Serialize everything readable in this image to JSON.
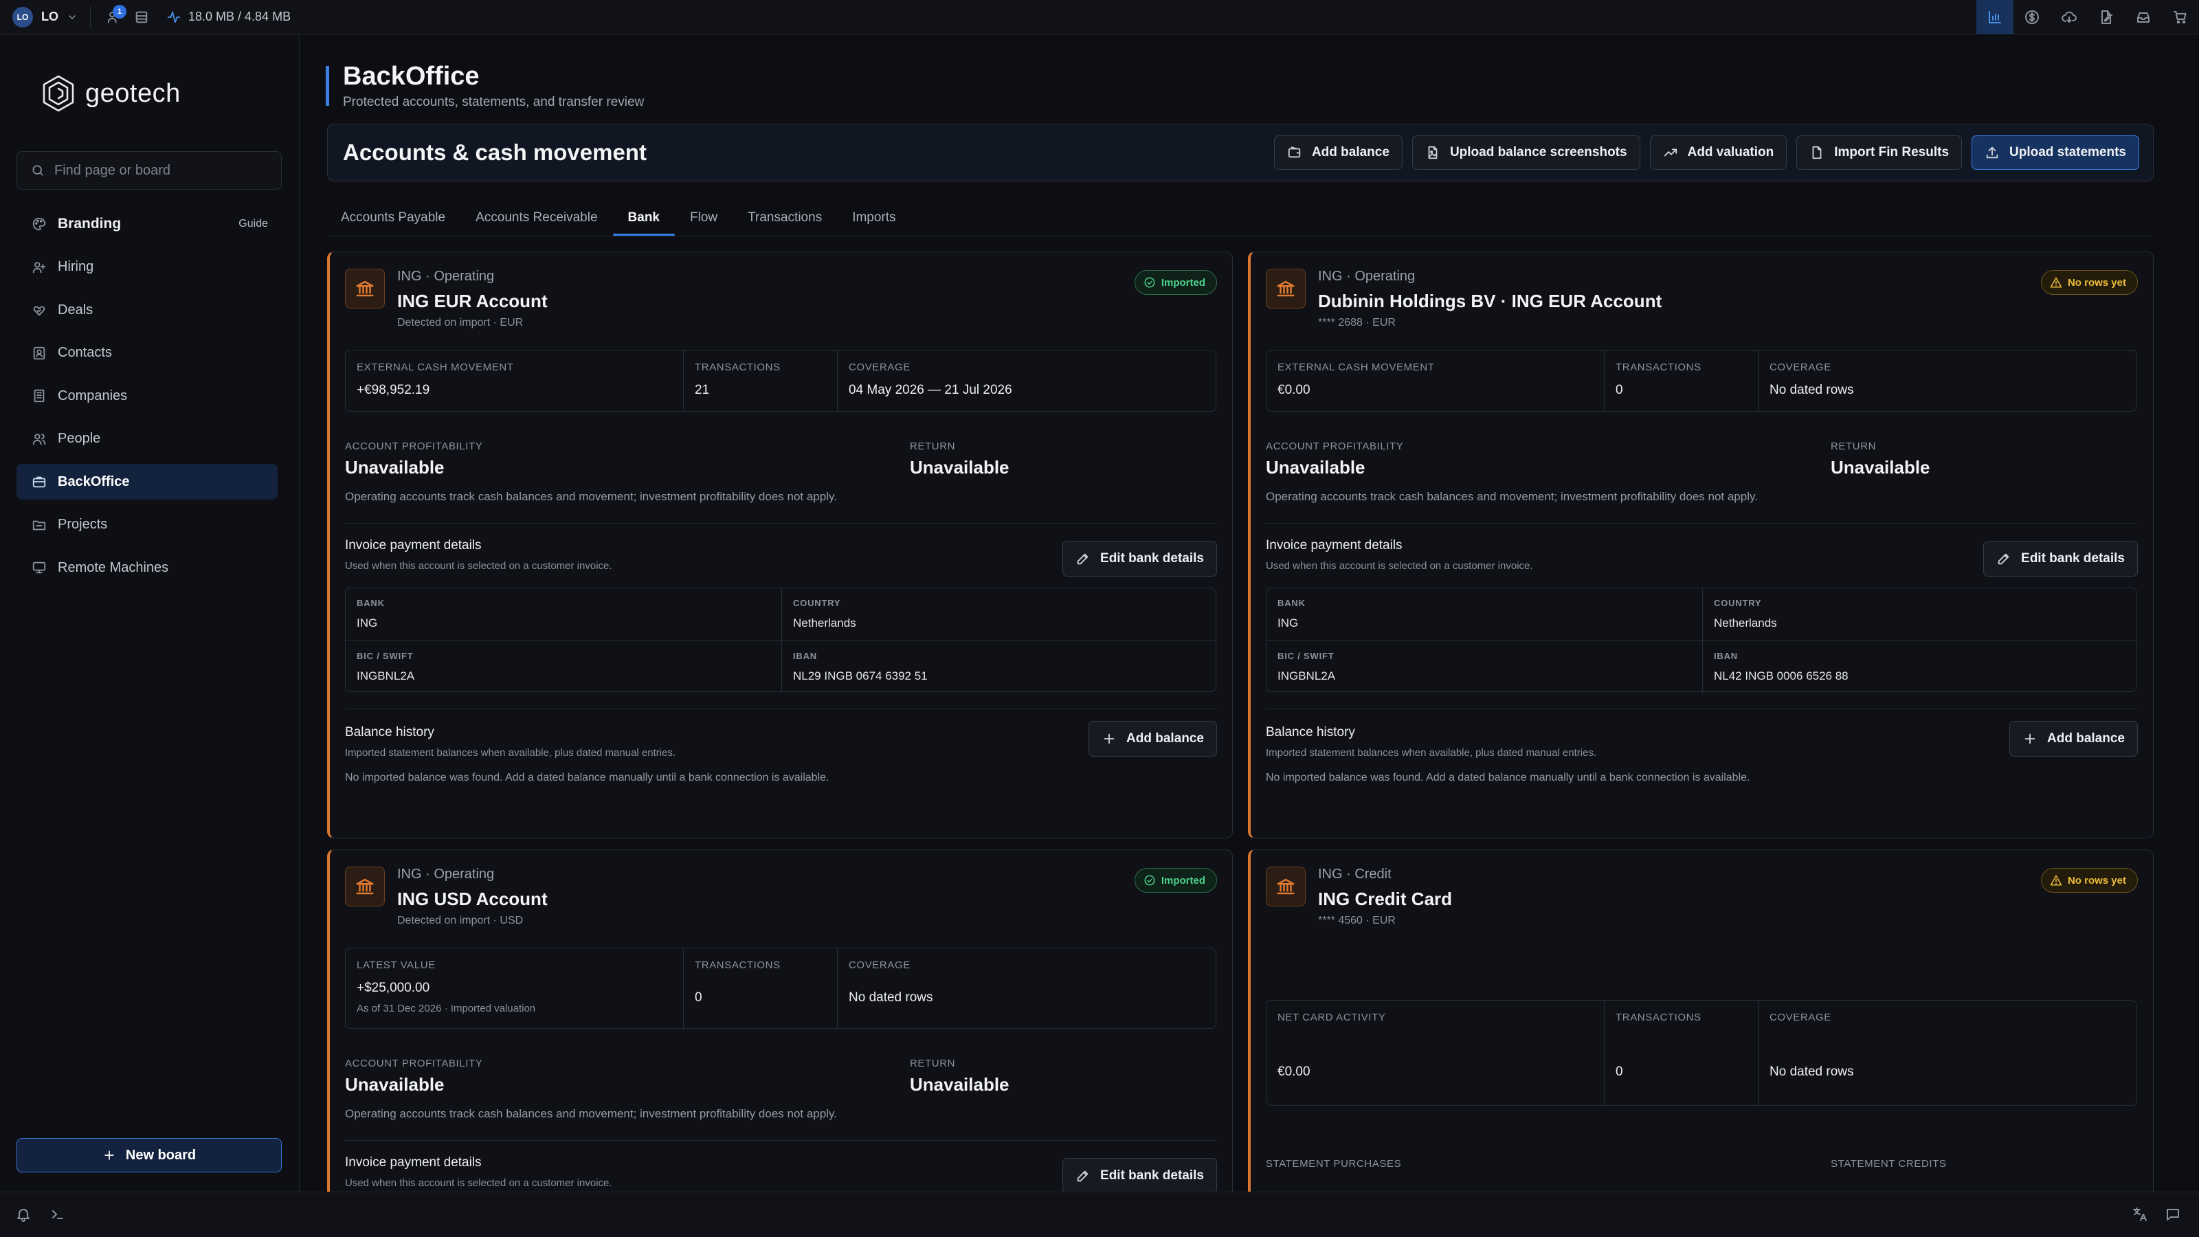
{
  "topbar": {
    "avatar_initials": "LO",
    "user_label": "LO",
    "notification_count": "1",
    "memory": "18.0 MB / 4.84 MB",
    "accent": "#3b7ee6"
  },
  "sidebar": {
    "logo_text": "geotech",
    "search_placeholder": "Find page or board",
    "items": [
      {
        "label": "Branding",
        "extra": "Guide",
        "icon": "palette-icon"
      },
      {
        "label": "Hiring",
        "icon": "user-plus-icon"
      },
      {
        "label": "Deals",
        "icon": "handshake-icon"
      },
      {
        "label": "Contacts",
        "icon": "contact-card-icon"
      },
      {
        "label": "Companies",
        "icon": "building-icon"
      },
      {
        "label": "People",
        "icon": "people-icon"
      },
      {
        "label": "BackOffice",
        "icon": "briefcase-icon"
      },
      {
        "label": "Projects",
        "icon": "folder-icon"
      },
      {
        "label": "Remote Machines",
        "icon": "monitor-icon"
      }
    ],
    "new_board_label": "New board"
  },
  "page": {
    "title": "BackOffice",
    "subtitle": "Protected accounts, statements, and transfer review",
    "section_title": "Accounts & cash movement",
    "actions": [
      "Add balance",
      "Upload balance screenshots",
      "Add valuation",
      "Import Fin Results",
      "Upload statements"
    ],
    "tabs": [
      "Accounts Payable",
      "Accounts Receivable",
      "Bank",
      "Flow",
      "Transactions",
      "Imports"
    ],
    "active_tab": "Bank"
  },
  "labels": {
    "account_profitability": "ACCOUNT PROFITABILITY",
    "return": "RETURN",
    "invoice_payment_details": "Invoice payment details",
    "invoice_payment_sub": "Used when this account is selected on a customer invoice.",
    "edit_bank_details": "Edit bank details",
    "bank": "BANK",
    "country": "COUNTRY",
    "bic_swift": "BIC / SWIFT",
    "iban": "IBAN",
    "balance_history": "Balance history",
    "balance_history_sub": "Imported statement balances when available, plus dated manual entries.",
    "add_balance": "Add balance",
    "operating_note": "Operating accounts track cash balances and movement; investment profitability does not apply.",
    "no_balance_note": "No imported balance was found. Add a dated balance manually until a bank connection is available.",
    "statement_purchases": "STATEMENT PURCHASES",
    "statement_credits": "STATEMENT CREDITS"
  },
  "accounts": [
    {
      "kicker": "ING · Operating",
      "title": "ING EUR Account",
      "sub": "Detected on import · EUR",
      "badge": "Imported",
      "metrics": [
        {
          "label": "EXTERNAL CASH MOVEMENT",
          "value": "+€98,952.19"
        },
        {
          "label": "TRANSACTIONS",
          "value": "21"
        },
        {
          "label": "COVERAGE",
          "value": "04 May 2026 — 21 Jul 2026"
        }
      ],
      "profitability": "Unavailable",
      "return": "Unavailable",
      "bank": "ING",
      "country": "Netherlands",
      "bic": "INGBNL2A",
      "iban": "NL29 INGB 0674 6392 51"
    },
    {
      "kicker": "ING · Operating",
      "title": "Dubinin Holdings BV · ING EUR Account",
      "sub": "**** 2688 · EUR",
      "badge": "No rows yet",
      "metrics": [
        {
          "label": "EXTERNAL CASH MOVEMENT",
          "value": "€0.00"
        },
        {
          "label": "TRANSACTIONS",
          "value": "0"
        },
        {
          "label": "COVERAGE",
          "value": "No dated rows"
        }
      ],
      "profitability": "Unavailable",
      "return": "Unavailable",
      "bank": "ING",
      "country": "Netherlands",
      "bic": "INGBNL2A",
      "iban": "NL42 INGB 0006 6526 88"
    },
    {
      "kicker": "ING · Operating",
      "title": "ING USD Account",
      "sub": "Detected on import · USD",
      "badge": "Imported",
      "metrics": [
        {
          "label": "LATEST VALUE",
          "value": "+$25,000.00",
          "note": "As of 31 Dec 2026 · Imported valuation"
        },
        {
          "label": "TRANSACTIONS",
          "value": "0"
        },
        {
          "label": "COVERAGE",
          "value": "No dated rows"
        }
      ],
      "profitability": "Unavailable",
      "return": "Unavailable"
    },
    {
      "kicker": "ING · Credit",
      "title": "ING Credit Card",
      "sub": "**** 4560 · EUR",
      "badge": "No rows yet",
      "metrics": [
        {
          "label": "NET CARD ACTIVITY",
          "value": "€0.00"
        },
        {
          "label": "TRANSACTIONS",
          "value": "0"
        },
        {
          "label": "COVERAGE",
          "value": "No dated rows"
        }
      ]
    }
  ]
}
